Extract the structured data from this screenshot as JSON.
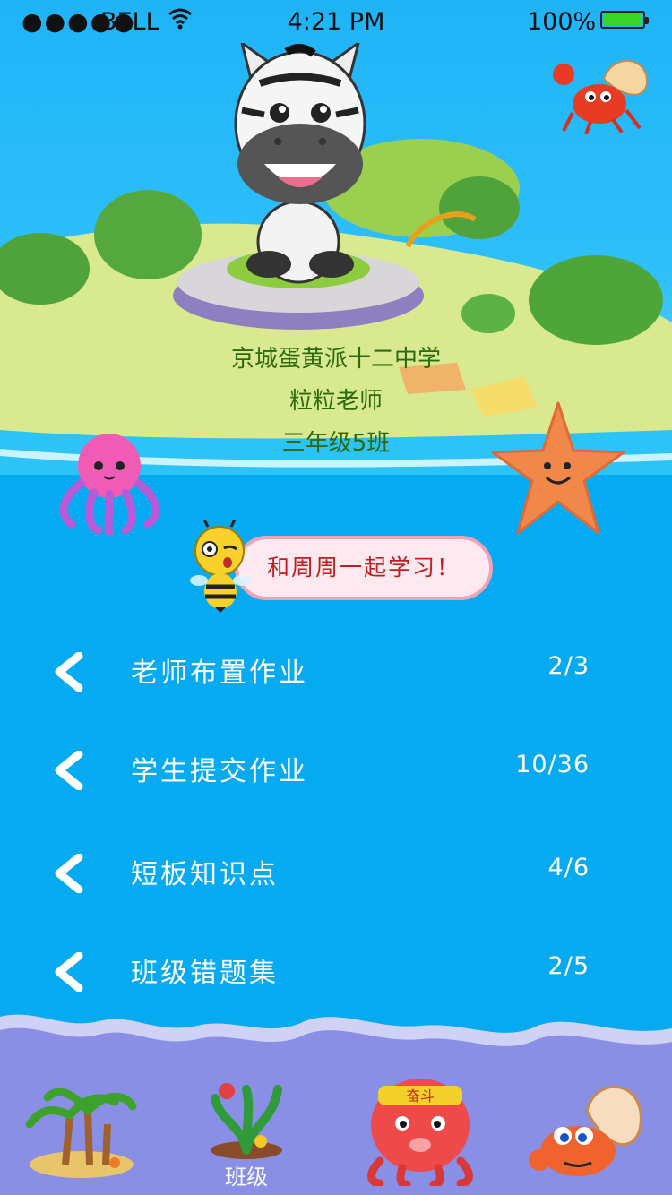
{
  "status_bar": {
    "signal": "●●●●●",
    "carrier": "BELL",
    "time": "4:21 PM",
    "battery_percent": "100%",
    "battery_level": 1.0
  },
  "school": {
    "name": "京城蛋黄派十二中学",
    "teacher": "粒粒老师",
    "class_name": "三年级5班"
  },
  "bubble_text": "和周周一起学习！",
  "menu": [
    {
      "label": "老师布置作业",
      "count": "2/3"
    },
    {
      "label": "学生提交作业",
      "count": "10/36"
    },
    {
      "label": "短板知识点",
      "count": "4/6"
    },
    {
      "label": "班级错题集",
      "count": "2/5"
    }
  ],
  "bottom_nav": {
    "items": [
      {
        "icon": "palm-island-icon"
      },
      {
        "icon": "coral-icon",
        "label": "班级"
      },
      {
        "icon": "octopus-fighter-icon"
      },
      {
        "icon": "hermit-crab-icon"
      }
    ],
    "headband_text": "奋斗"
  },
  "colors": {
    "sky": "#1fb4f7",
    "sea": "#06aaf0",
    "island": "#d6e68a",
    "info_text": "#2c6a10",
    "bubble_bg": "#fde9ef",
    "bubble_text": "#c01f1f",
    "bottom_band": "#8a8fe6"
  }
}
